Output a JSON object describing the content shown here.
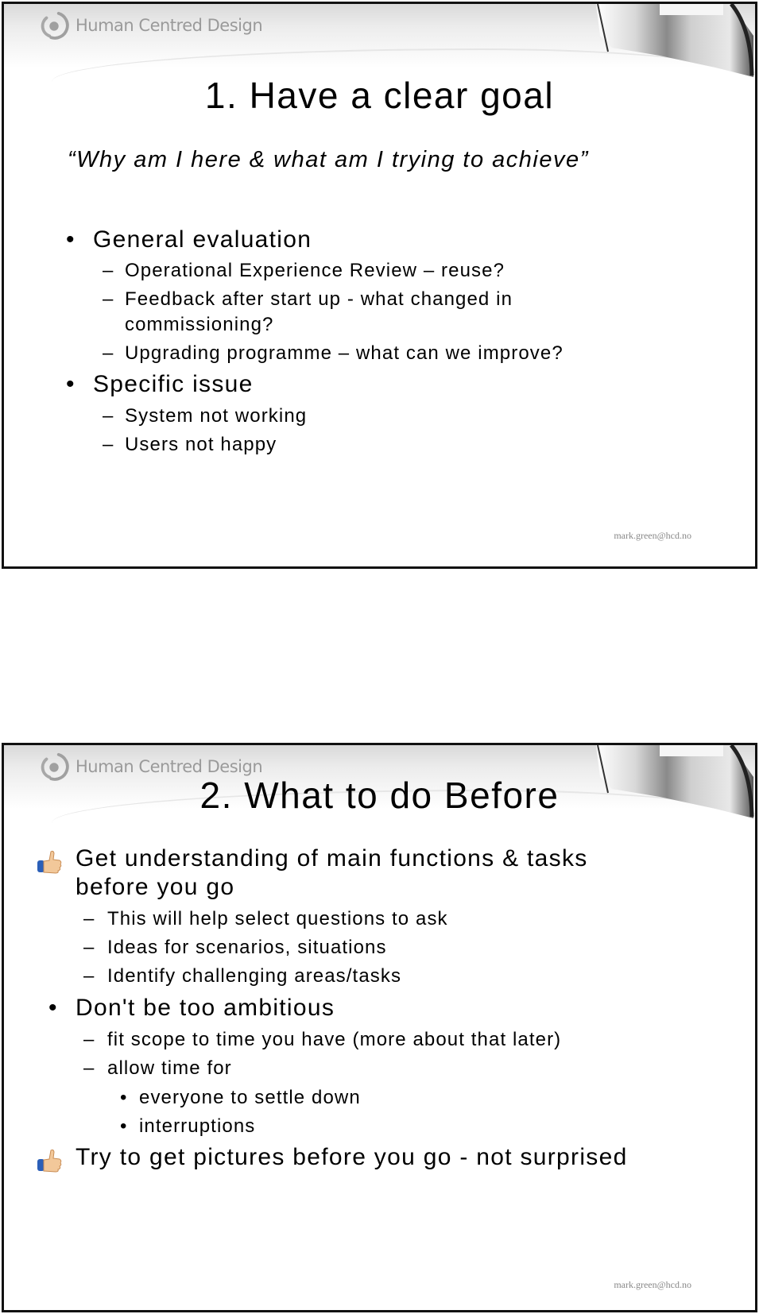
{
  "header": {
    "logo_text": "Human Centred Design"
  },
  "slides": [
    {
      "title": "1. Have a clear goal",
      "subtitle": "“Why am I here & what am I trying to achieve”",
      "items": [
        {
          "level": 1,
          "bullet": "dot",
          "text": "General evaluation"
        },
        {
          "level": 2,
          "bullet": "dash",
          "text": "Operational Experience Review – reuse?"
        },
        {
          "level": 2,
          "bullet": "dash",
          "text": "Feedback after start up - what changed in"
        },
        {
          "level": 2,
          "bullet": "none",
          "text": "commissioning?"
        },
        {
          "level": 2,
          "bullet": "dash",
          "text": "Upgrading programme – what can we improve?"
        },
        {
          "level": 1,
          "bullet": "dot",
          "text": "Specific issue"
        },
        {
          "level": 2,
          "bullet": "dash",
          "text": "System not working"
        },
        {
          "level": 2,
          "bullet": "dash",
          "text": "Users not happy"
        }
      ],
      "footer": "mark.green@hcd.no"
    },
    {
      "title": "2. What to do Before",
      "items": [
        {
          "level": 1,
          "bullet": "thumbs-up",
          "text": "Get understanding of main functions & tasks"
        },
        {
          "level": 1,
          "bullet": "none",
          "text": "before you go"
        },
        {
          "level": 2,
          "bullet": "dash",
          "text": "This will help select questions to ask"
        },
        {
          "level": 2,
          "bullet": "dash",
          "text": "Ideas for scenarios, situations"
        },
        {
          "level": 2,
          "bullet": "dash",
          "text": "Identify challenging areas/tasks"
        },
        {
          "level": 1,
          "bullet": "dot",
          "text": "Don't be too ambitious"
        },
        {
          "level": 2,
          "bullet": "dash",
          "text": "fit scope to time you have (more about that later)"
        },
        {
          "level": 2,
          "bullet": "dash",
          "text": "allow time for"
        },
        {
          "level": 3,
          "bullet": "dot",
          "text": "everyone to settle down"
        },
        {
          "level": 3,
          "bullet": "dot",
          "text": "interruptions"
        },
        {
          "level": 1,
          "bullet": "thumbs-up",
          "text": "Try to get pictures before you go - not surprised"
        }
      ],
      "footer": "mark.green@hcd.no"
    }
  ],
  "glyphs": {
    "dot": "•",
    "dash": "–"
  }
}
